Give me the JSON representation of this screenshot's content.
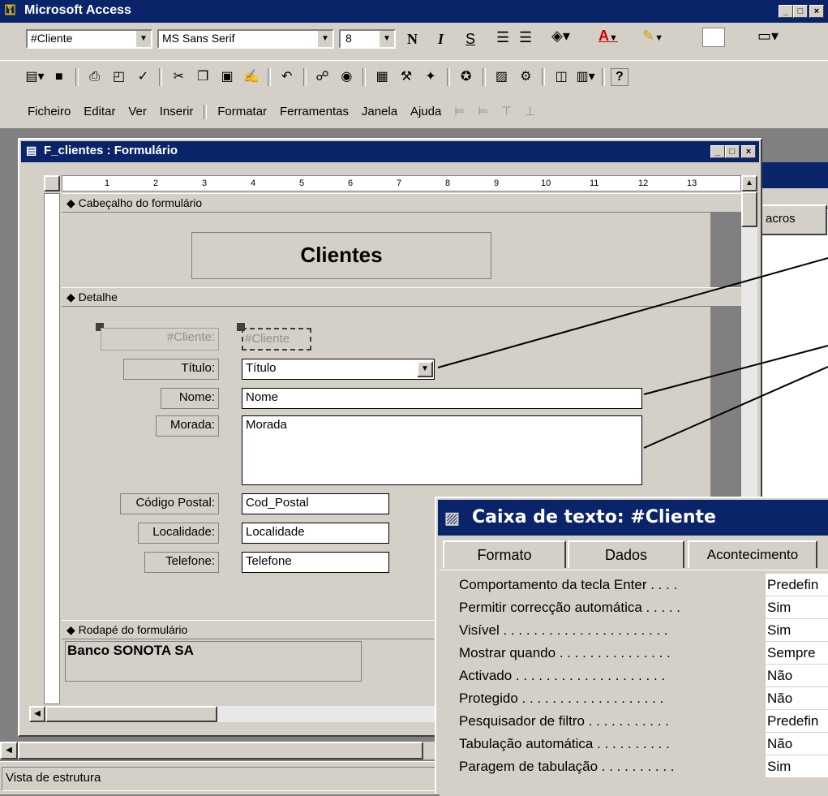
{
  "app": {
    "title": "Microsoft Access"
  },
  "format_toolbar": {
    "object_combo": "#Cliente",
    "font_combo": "MS Sans Serif",
    "size_combo": "8",
    "bold": "N",
    "italic": "I",
    "underline": "S"
  },
  "menu": [
    "Ficheiro",
    "Editar",
    "Ver",
    "Inserir",
    "Formatar",
    "Ferramentas",
    "Janela",
    "Ajuda"
  ],
  "form_window": {
    "title": "F_clientes : Formulário",
    "ruler_numbers": [
      "1",
      "2",
      "3",
      "4",
      "5",
      "6",
      "7",
      "8",
      "9",
      "10",
      "11",
      "12",
      "13"
    ]
  },
  "sections": {
    "header": "Cabeçalho do formulário",
    "detail": "Detalhe",
    "footer": "Rodapé do formulário"
  },
  "form": {
    "title": "Clientes",
    "fields": [
      {
        "label": "#Cliente:",
        "value": "#Cliente"
      },
      {
        "label": "Título:",
        "value": "Título"
      },
      {
        "label": "Nome:",
        "value": "Nome"
      },
      {
        "label": "Morada:",
        "value": "Morada"
      },
      {
        "label": "Código Postal:",
        "value": "Cod_Postal"
      },
      {
        "label": "Localidade:",
        "value": "Localidade"
      },
      {
        "label": "Telefone:",
        "value": "Telefone"
      }
    ],
    "footer_text": "Banco SONOTA SA"
  },
  "background_tab": "acros",
  "properties": {
    "title": "Caixa de texto: #Cliente",
    "tabs": [
      "Formato",
      "Dados",
      "Acontecimento"
    ],
    "rows": [
      {
        "name": "Comportamento da tecla Enter . . . .",
        "value": "Predefin"
      },
      {
        "name": "Permitir correcção automática . . . . .",
        "value": "Sim"
      },
      {
        "name": "Visível . . . . . . . . . . . . . . . . . . . . . .",
        "value": "Sim"
      },
      {
        "name": "Mostrar quando . . . . . . . . . . . . . . .",
        "value": "Sempre"
      },
      {
        "name": "Activado . . . . . . . . . . . . . . . . . . . .",
        "value": "Não"
      },
      {
        "name": "Protegido . . . . . . . . . . . . . . . . . . .",
        "value": "Não"
      },
      {
        "name": "Pesquisador de filtro . . . . . . . . . . .",
        "value": "Predefin"
      },
      {
        "name": "Tabulação automática . . . . . . . . . .",
        "value": "Não"
      },
      {
        "name": "Paragem de tabulação . . . . . . . . . .",
        "value": "Sim"
      }
    ]
  },
  "statusbar": {
    "text": "Vista de estrutura"
  }
}
